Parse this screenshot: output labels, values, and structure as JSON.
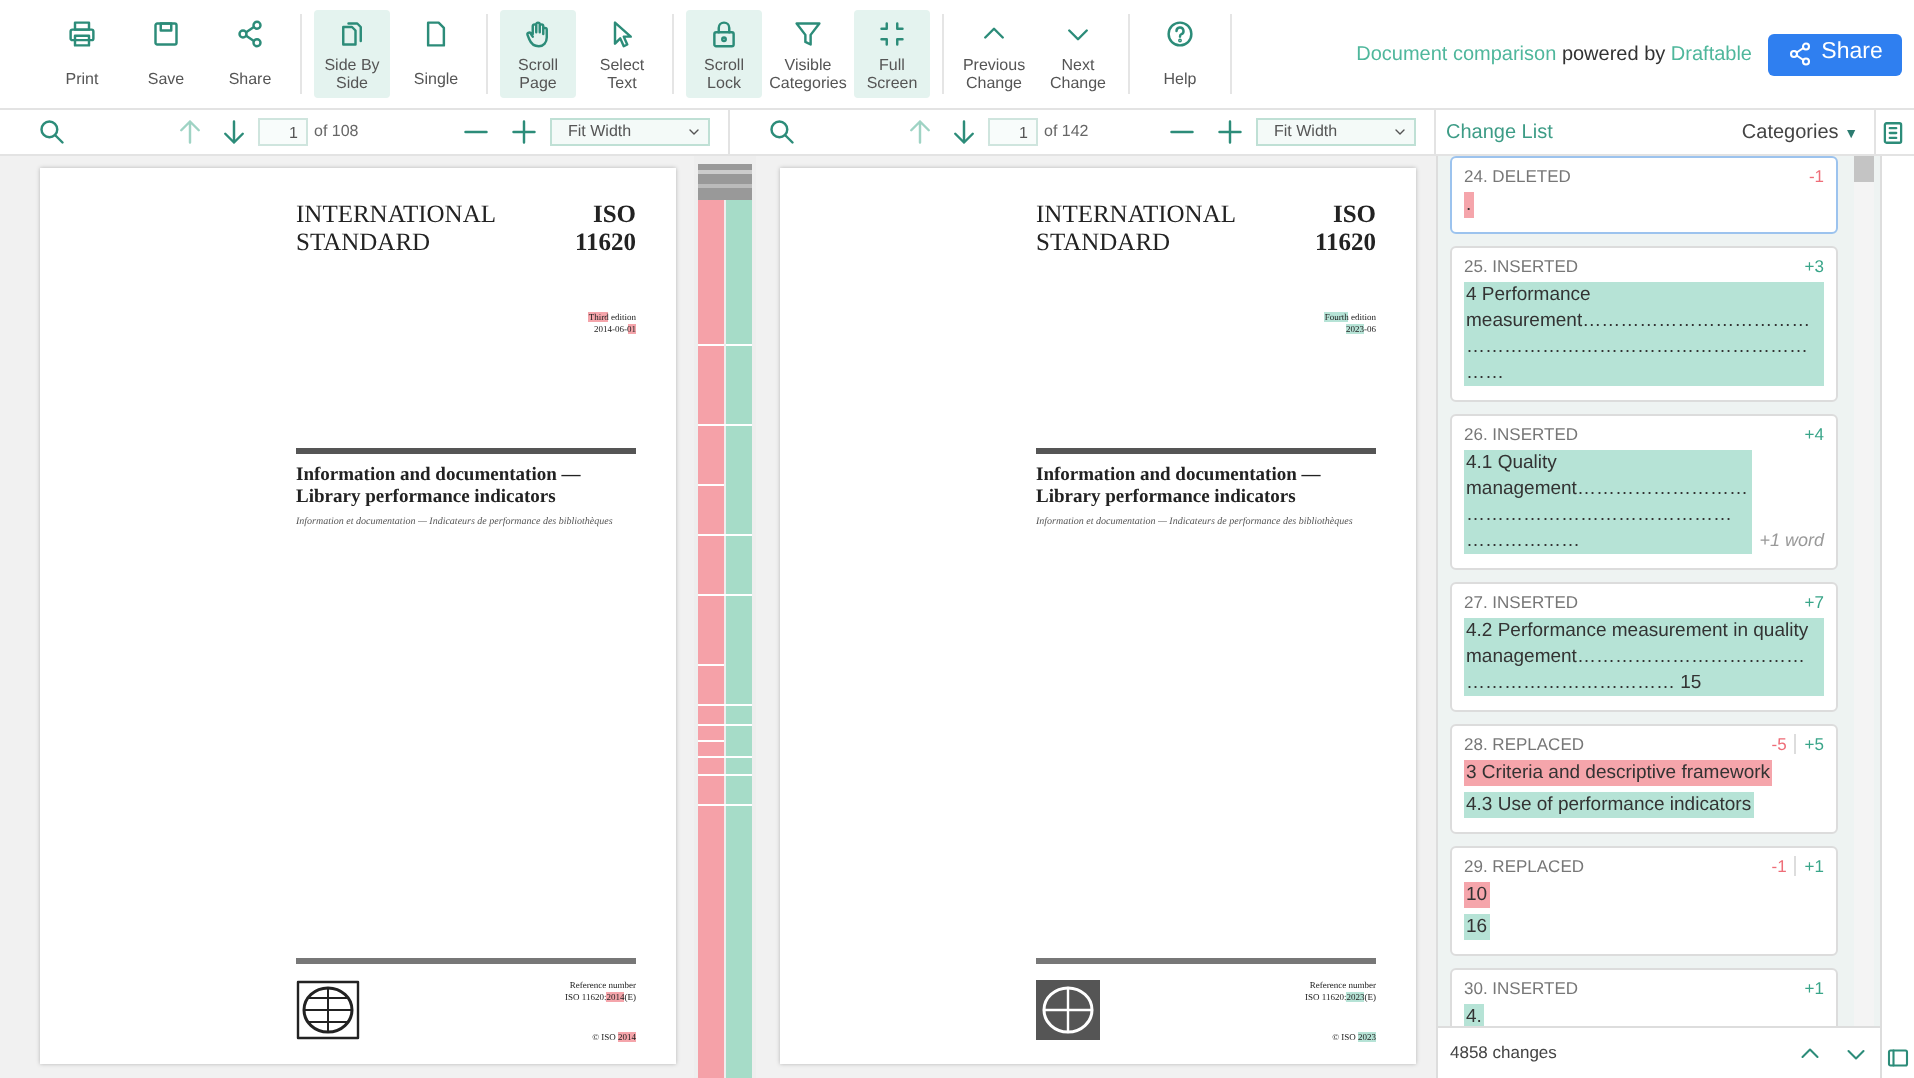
{
  "toolbar": {
    "groups": [
      [
        {
          "label": "Print",
          "kind": "print",
          "selected": false
        },
        {
          "label": "Save",
          "kind": "save",
          "selected": false
        },
        {
          "label": "Share",
          "kind": "share",
          "selected": false
        }
      ],
      [
        {
          "label": "Side By Side",
          "kind": "sidebyside",
          "selected": true
        },
        {
          "label": "Single",
          "kind": "single",
          "selected": false
        }
      ],
      [
        {
          "label": "Scroll Page",
          "kind": "hand",
          "selected": true
        },
        {
          "label": "Select Text",
          "kind": "cursor",
          "selected": false
        }
      ],
      [
        {
          "label": "Scroll Lock",
          "kind": "lock",
          "selected": true
        },
        {
          "label": "Visible Categories",
          "kind": "filter",
          "selected": false
        },
        {
          "label": "Full Screen",
          "kind": "fullscreen",
          "selected": true
        }
      ],
      [
        {
          "label": "Previous Change",
          "kind": "up",
          "selected": false
        },
        {
          "label": "Next Change",
          "kind": "down",
          "selected": false
        }
      ],
      [
        {
          "label": "Help",
          "kind": "help",
          "selected": false
        }
      ]
    ],
    "branding": {
      "product": "Document comparison",
      "middle": "powered by",
      "company": "Draftable"
    },
    "share_button": "Share"
  },
  "panes": [
    {
      "page": "1",
      "page_count": "of 108",
      "zoom": "Fit Width",
      "document": {
        "title_lines": [
          "INTERNATIONAL",
          "STANDARD"
        ],
        "code_lines": [
          "ISO",
          "11620"
        ],
        "edition": [
          {
            "text": "Third",
            "kind": "deleted"
          },
          {
            "text": " edition",
            "kind": "plain"
          }
        ],
        "date": [
          {
            "text": "2014-06-",
            "kind": "plain"
          },
          {
            "text": "01",
            "kind": "deleted"
          }
        ],
        "title": "Information and documentation — Library performance indicators",
        "subtitle": "Information et documentation — Indicateurs de performance des bibliothèques",
        "ref_label": "Reference number",
        "ref": [
          {
            "text": "ISO 11620:",
            "kind": "plain"
          },
          {
            "text": "2014",
            "kind": "deleted"
          },
          {
            "text": "(E)",
            "kind": "plain"
          }
        ],
        "copyright": [
          {
            "text": "© ISO ",
            "kind": "plain"
          },
          {
            "text": "2014",
            "kind": "deleted"
          }
        ],
        "logo": {
          "kind": "outline"
        }
      }
    },
    {
      "page": "1",
      "page_count": "of 142",
      "zoom": "Fit Width",
      "document": {
        "title_lines": [
          "INTERNATIONAL",
          "STANDARD"
        ],
        "code_lines": [
          "ISO",
          "11620"
        ],
        "edition": [
          {
            "text": "Fourth",
            "kind": "inserted"
          },
          {
            "text": " edition",
            "kind": "plain"
          }
        ],
        "date": [
          {
            "text": "2023",
            "kind": "inserted"
          },
          {
            "text": "-06",
            "kind": "plain"
          }
        ],
        "title": "Information and documentation — Library performance indicators",
        "subtitle": "Information et documentation — Indicateurs de performance des bibliothèques",
        "ref_label": "Reference number",
        "ref": [
          {
            "text": "ISO 11620:",
            "kind": "plain"
          },
          {
            "text": "2023",
            "kind": "inserted"
          },
          {
            "text": "(E)",
            "kind": "plain"
          }
        ],
        "copyright": [
          {
            "text": "© ISO ",
            "kind": "plain"
          },
          {
            "text": "2023",
            "kind": "inserted"
          }
        ],
        "logo": {
          "kind": "filled"
        }
      }
    }
  ],
  "change_list": {
    "title": "Change List",
    "categories": "Categories",
    "categories_caret": "▼",
    "items": [
      {
        "heading": "24. DELETED",
        "selected": true,
        "deleted_count": "-1",
        "lines": [
          {
            "kind": "deleted",
            "text": "."
          }
        ]
      },
      {
        "heading": "25. INSERTED",
        "selected": false,
        "inserted_count": "+3",
        "lines": [
          {
            "kind": "inserted",
            "text": "4 Performance measurement……………………………………………………………………………………"
          }
        ]
      },
      {
        "heading": "26. INSERTED",
        "selected": false,
        "inserted_count": "+4",
        "lines": [
          {
            "kind": "inserted",
            "text": "4.1  Quality management……………………………………………………………………………",
            "note": "+1 word"
          }
        ]
      },
      {
        "heading": "27. INSERTED",
        "selected": false,
        "inserted_count": "+7",
        "lines": [
          {
            "kind": "inserted",
            "text": "4.2  Performance measurement in quality management…………………………………………………………… 15"
          }
        ]
      },
      {
        "heading": "28. REPLACED",
        "selected": false,
        "deleted_count": "-5",
        "inserted_count": "+5",
        "lines": [
          {
            "kind": "deleted",
            "text": "3     Criteria and descriptive framework"
          },
          {
            "kind": "inserted",
            "text": "4.3  Use of performance indicators"
          }
        ]
      },
      {
        "heading": "29. REPLACED",
        "selected": false,
        "deleted_count": "-1",
        "inserted_count": "+1",
        "lines": [
          {
            "kind": "deleted",
            "text": "10"
          },
          {
            "kind": "inserted",
            "text": " 16"
          }
        ]
      },
      {
        "heading": "30. INSERTED",
        "selected": false,
        "inserted_count": "+1",
        "lines": [
          {
            "kind": "inserted",
            "text": "4."
          }
        ]
      }
    ],
    "footer": "4858 changes"
  }
}
